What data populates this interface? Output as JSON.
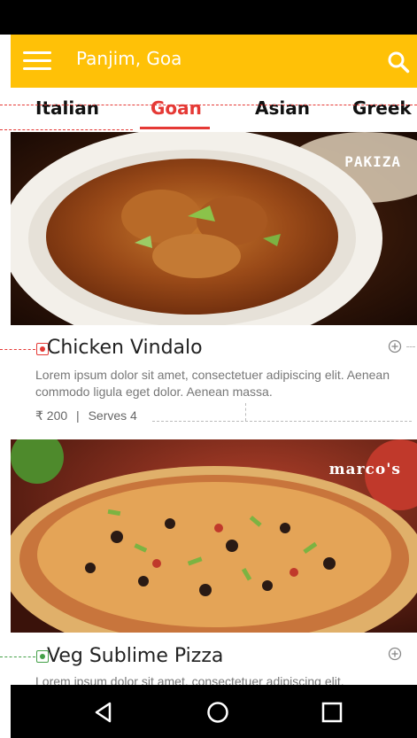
{
  "app": {
    "location": "Panjim, Goa"
  },
  "tabs": [
    {
      "label": "Italian",
      "active": false
    },
    {
      "label": "Goan",
      "active": true
    },
    {
      "label": "Asian",
      "active": false
    },
    {
      "label": "Greek",
      "active": false
    }
  ],
  "dishes": [
    {
      "brand": "PAKIZA",
      "title": "Chicken Vindalo",
      "type": "non-veg",
      "description": "Lorem ipsum dolor sit amet, consectetuer adipiscing elit. Aenean commodo ligula eget dolor. Aenean massa.",
      "price": "₹ 200",
      "separator": "|",
      "serves": "Serves 4"
    },
    {
      "brand": "marco's",
      "title": "Veg Sublime Pizza",
      "type": "veg",
      "description": "Lorem ipsum dolor sit amet, consectetuer adipiscing elit."
    }
  ],
  "icons": {
    "menu": "hamburger-icon",
    "search": "search-icon",
    "add": "plus-circle-icon",
    "nav_back": "triangle-back-icon",
    "nav_home": "circle-home-icon",
    "nav_recent": "square-recents-icon"
  },
  "colors": {
    "accent": "#FFC107",
    "tab_active": "#E53935",
    "non_veg": "#E53935",
    "veg": "#43A047"
  }
}
